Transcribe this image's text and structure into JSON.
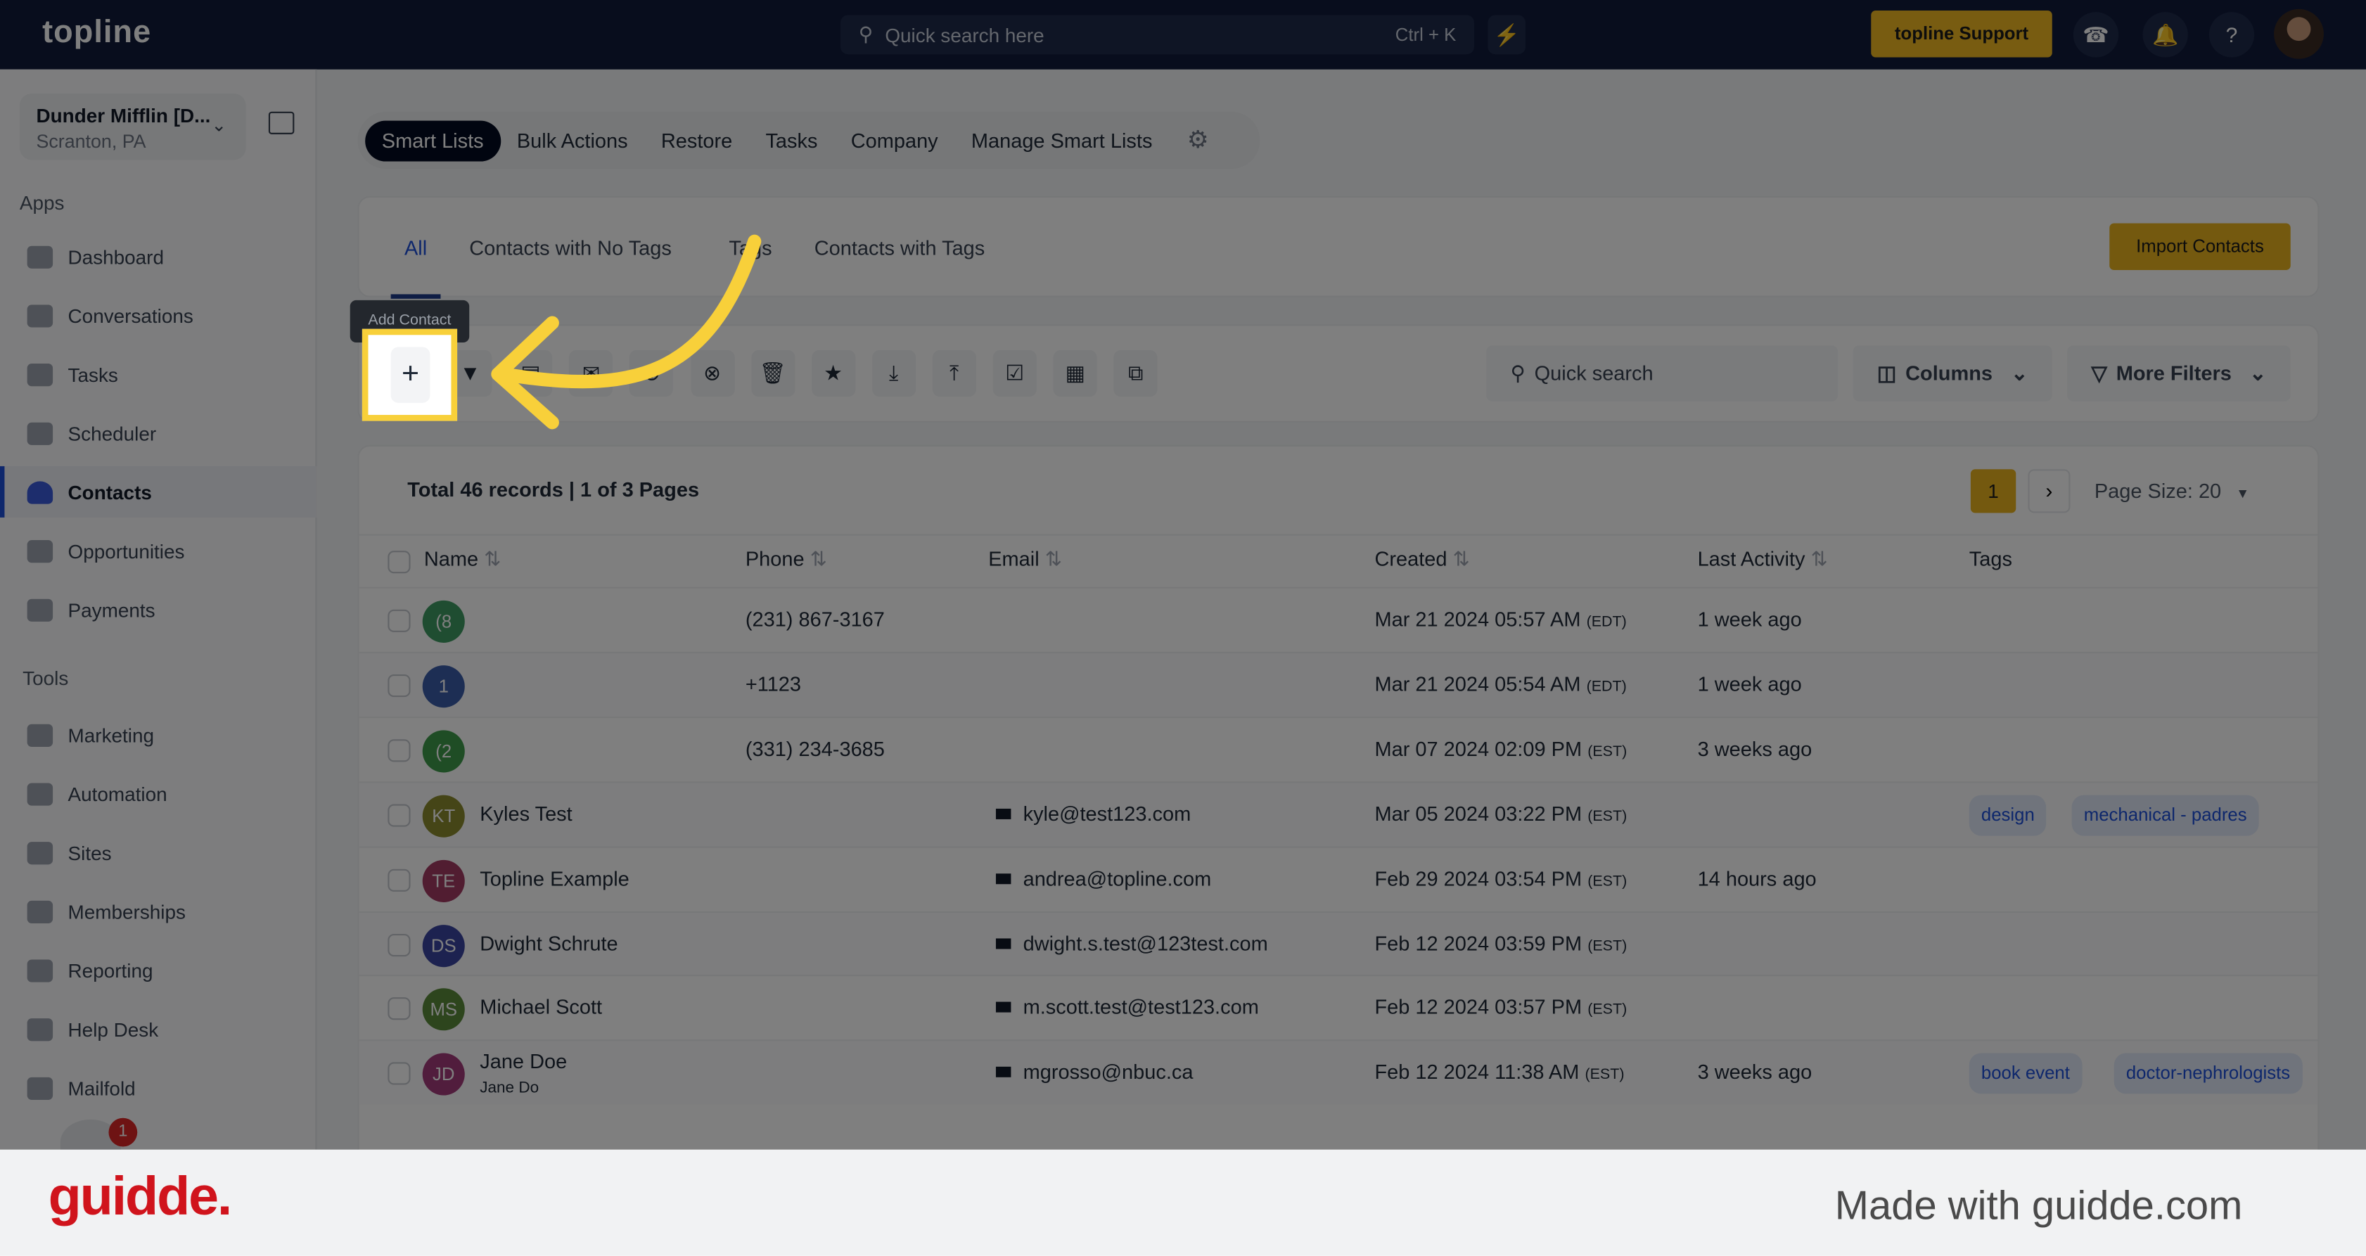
{
  "topbar": {
    "logo": "topline",
    "search_placeholder": "Quick search here",
    "search_shortcut": "Ctrl + K",
    "support_label": "topline Support"
  },
  "account": {
    "name": "Dunder Mifflin [D...",
    "location": "Scranton, PA"
  },
  "sidebar": {
    "apps_label": "Apps",
    "tools_label": "Tools",
    "apps": [
      {
        "label": "Dashboard"
      },
      {
        "label": "Conversations"
      },
      {
        "label": "Tasks"
      },
      {
        "label": "Scheduler"
      },
      {
        "label": "Contacts",
        "active": true
      },
      {
        "label": "Opportunities"
      },
      {
        "label": "Payments"
      }
    ],
    "tools": [
      {
        "label": "Marketing"
      },
      {
        "label": "Automation"
      },
      {
        "label": "Sites"
      },
      {
        "label": "Memberships"
      },
      {
        "label": "Reporting"
      },
      {
        "label": "Help Desk"
      },
      {
        "label": "Mailfold"
      }
    ],
    "notification_count": "1"
  },
  "nav_tabs": [
    {
      "label": "Smart Lists",
      "active": true
    },
    {
      "label": "Bulk Actions"
    },
    {
      "label": "Restore"
    },
    {
      "label": "Tasks"
    },
    {
      "label": "Company"
    },
    {
      "label": "Manage Smart Lists"
    }
  ],
  "list_tabs": [
    {
      "label": "All",
      "active": true
    },
    {
      "label": "Contacts with No Tags"
    },
    {
      "label": "Tags"
    },
    {
      "label": "Contacts with Tags"
    }
  ],
  "import_label": "Import Contacts",
  "tooltip": "Add Contact",
  "toolbar": {
    "icons": [
      "plus-icon",
      "filter-icon",
      "message-icon",
      "email-icon",
      "add-tag-icon",
      "remove-tag-icon",
      "trash-icon",
      "star-icon",
      "download-icon",
      "upload-icon",
      "review-icon",
      "company-icon",
      "merge-icon"
    ],
    "search_placeholder": "Quick search",
    "columns_label": "Columns",
    "more_filters_label": "More Filters"
  },
  "table": {
    "summary": "Total 46 records | 1 of 3 Pages",
    "current_page": "1",
    "page_size": "Page Size: 20",
    "headers": [
      "Name",
      "Phone",
      "Email",
      "Created",
      "Last Activity",
      "Tags"
    ],
    "rows": [
      {
        "initials": "(8",
        "color": "#3f9a63",
        "name": "",
        "sub": "",
        "phone": "(231) 867-3167",
        "email": "",
        "created": "Mar 21 2024 05:57 AM",
        "tz": "(EDT)",
        "activity": "1 week ago",
        "tags": []
      },
      {
        "initials": "1",
        "color": "#3b5ca8",
        "name": "",
        "sub": "",
        "phone": "+1123",
        "email": "",
        "created": "Mar 21 2024 05:54 AM",
        "tz": "(EDT)",
        "activity": "1 week ago",
        "tags": []
      },
      {
        "initials": "(2",
        "color": "#3f9a4a",
        "name": "",
        "sub": "",
        "phone": "(331) 234-3685",
        "email": "",
        "created": "Mar 07 2024 02:09 PM",
        "tz": "(EST)",
        "activity": "3 weeks ago",
        "tags": []
      },
      {
        "initials": "KT",
        "color": "#8a8a2e",
        "name": "Kyles Test",
        "sub": "",
        "phone": "",
        "email": "kyle@test123.com",
        "created": "Mar 05 2024 03:22 PM",
        "tz": "(EST)",
        "activity": "",
        "tags": [
          "design",
          "mechanical - padres"
        ]
      },
      {
        "initials": "TE",
        "color": "#a23a62",
        "name": "Topline Example",
        "sub": "",
        "phone": "",
        "email": "andrea@topline.com",
        "created": "Feb 29 2024 03:54 PM",
        "tz": "(EST)",
        "activity": "14 hours ago",
        "tags": []
      },
      {
        "initials": "DS",
        "color": "#3a45a0",
        "name": "Dwight Schrute",
        "sub": "",
        "phone": "",
        "email": "dwight.s.test@123test.com",
        "created": "Feb 12 2024 03:59 PM",
        "tz": "(EST)",
        "activity": "",
        "tags": []
      },
      {
        "initials": "MS",
        "color": "#5a8a3a",
        "name": "Michael Scott",
        "sub": "",
        "phone": "",
        "email": "m.scott.test@test123.com",
        "created": "Feb 12 2024 03:57 PM",
        "tz": "(EST)",
        "activity": "",
        "tags": []
      },
      {
        "initials": "JD",
        "color": "#a23a7a",
        "name": "Jane Doe",
        "sub": "Jane Do",
        "phone": "",
        "email": "mgrosso@nbuc.ca",
        "created": "Feb 12 2024 11:38 AM",
        "tz": "(EST)",
        "activity": "3 weeks ago",
        "tags": [
          "book event",
          "doctor-nephrologists"
        ]
      }
    ]
  },
  "footer": {
    "brand": "guidde.",
    "made_with": "Made with guidde.com"
  },
  "colors": {
    "accent": "#e9b21f",
    "highlight": "#f8d03a",
    "topbar": "#101a3a",
    "active_tab": "#1d4ed8"
  }
}
